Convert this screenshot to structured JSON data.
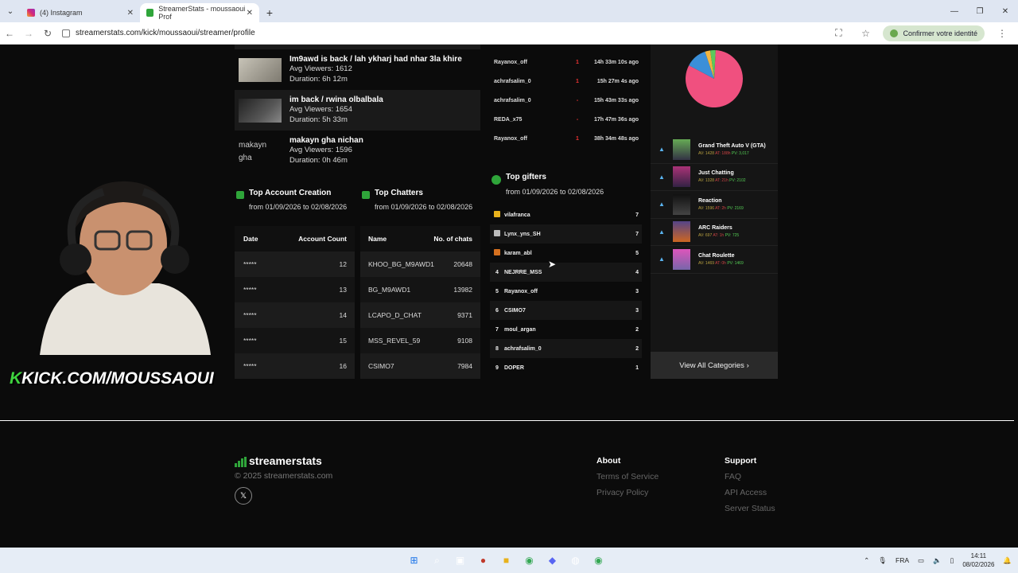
{
  "browser": {
    "tabs": [
      {
        "label": "(4) Instagram"
      },
      {
        "label": "StreamerStats - moussaoui Prof"
      }
    ],
    "url": "streamerstats.com/kick/moussaoui/streamer/profile",
    "identity_label": "Confirmer votre identité"
  },
  "streams": [
    {
      "title": "Im9awd is back / lah ykharj had nhar 3la khire",
      "avg": "Avg Viewers: 1612",
      "duration": "Duration: 6h 12m"
    },
    {
      "title": "im back / rwina olbalbala",
      "avg": "Avg Viewers: 1654",
      "duration": "Duration: 5h 33m"
    },
    {
      "title": "makayn gha nichan",
      "thumb_alt": "makayn gha",
      "avg": "Avg Viewers: 1596",
      "duration": "Duration: 0h 46m"
    }
  ],
  "recent_chatters": [
    {
      "name": "Rayanox_off",
      "count": "1",
      "time": "14h 33m 10s ago"
    },
    {
      "name": "achrafsalim_0",
      "count": "1",
      "time": "15h 27m 4s ago"
    },
    {
      "name": "achrafsalim_0",
      "count": "-",
      "time": "15h 43m 33s ago"
    },
    {
      "name": "REDA_x75",
      "count": "-",
      "time": "17h 47m 36s ago"
    },
    {
      "name": "Rayanox_off",
      "count": "1",
      "time": "38h 34m 48s ago"
    }
  ],
  "top_account_creation": {
    "title": "Top Account Creation",
    "date": "from 01/09/2026 to 02/08/2026",
    "col_date": "Date",
    "col_count": "Account Count",
    "rows": [
      {
        "date": "*****",
        "count": "12"
      },
      {
        "date": "*****",
        "count": "13"
      },
      {
        "date": "*****",
        "count": "14"
      },
      {
        "date": "*****",
        "count": "15"
      },
      {
        "date": "*****",
        "count": "16"
      }
    ]
  },
  "top_chatters": {
    "title": "Top Chatters",
    "date": "from 01/09/2026 to 02/08/2026",
    "col_name": "Name",
    "col_chats": "No. of chats",
    "rows": [
      {
        "name": "KHOO_BG_M9AWD1",
        "chats": "20648"
      },
      {
        "name": "BG_M9AWD1",
        "chats": "13982"
      },
      {
        "name": "LCAPO_D_CHAT",
        "chats": "9371"
      },
      {
        "name": "MSS_REVEL_59",
        "chats": "9108"
      },
      {
        "name": "CSIMO7",
        "chats": "7984"
      }
    ]
  },
  "top_gifters": {
    "title": "Top gifters",
    "date": "from 01/09/2026 to 02/08/2026",
    "rows": [
      {
        "rank": "",
        "icon": "gold-gift-icon",
        "name": "vilafranca",
        "count": "7"
      },
      {
        "rank": "",
        "icon": "silver-gift-icon",
        "name": "Lynx_yns_SH",
        "count": "7"
      },
      {
        "rank": "",
        "icon": "bronze-gift-icon",
        "name": "karam_abl",
        "count": "5"
      },
      {
        "rank": "4",
        "name": "NEJRRE_MSS",
        "count": "4"
      },
      {
        "rank": "5",
        "name": "Rayanox_off",
        "count": "3"
      },
      {
        "rank": "6",
        "name": "CSIMO7",
        "count": "3"
      },
      {
        "rank": "7",
        "name": "moul_argan",
        "count": "2"
      },
      {
        "rank": "8",
        "name": "achrafsalim_0",
        "count": "2"
      },
      {
        "rank": "9",
        "name": "DOPER",
        "count": "1"
      }
    ]
  },
  "categories": [
    {
      "name": "Grand Theft Auto V (GTA)",
      "av": "AV: 1428",
      "at": "AT: 188h",
      "pv": "PV: 3,017"
    },
    {
      "name": "Just Chatting",
      "av": "AV: 1328",
      "at": "AT: 21h",
      "pv": "PV: 2102"
    },
    {
      "name": "Reaction",
      "av": "AV: 1596",
      "at": "AT: 2h",
      "pv": "PV: 2169"
    },
    {
      "name": "ARC Raiders",
      "av": "AV: 697",
      "at": "AT: 1h",
      "pv": "PV: 725"
    },
    {
      "name": "Chat Roulette",
      "av": "AV: 1469",
      "at": "AT: 0h",
      "pv": "PV: 1469"
    }
  ],
  "view_all": "View All Categories",
  "pie": {
    "slices": [
      {
        "color": "#f0507f",
        "share": 0.82
      },
      {
        "color": "#3b8fd8",
        "share": 0.12
      },
      {
        "color": "#f2b640",
        "share": 0.03
      },
      {
        "color": "#5cc95c",
        "share": 0.03
      }
    ]
  },
  "footer": {
    "brand": "streamerstats",
    "copyright": "© 2025 streamerstats.com",
    "about": {
      "title": "About",
      "links": [
        "Terms of Service",
        "Privacy Policy"
      ]
    },
    "support": {
      "title": "Support",
      "links": [
        "FAQ",
        "API Access",
        "Server Status"
      ]
    }
  },
  "overlay": {
    "k": "K",
    "text": "KICK.COM/MOUSSAOUI"
  },
  "taskbar": {
    "lang": "FRA",
    "time": "14:11",
    "date": "08/02/2026"
  }
}
